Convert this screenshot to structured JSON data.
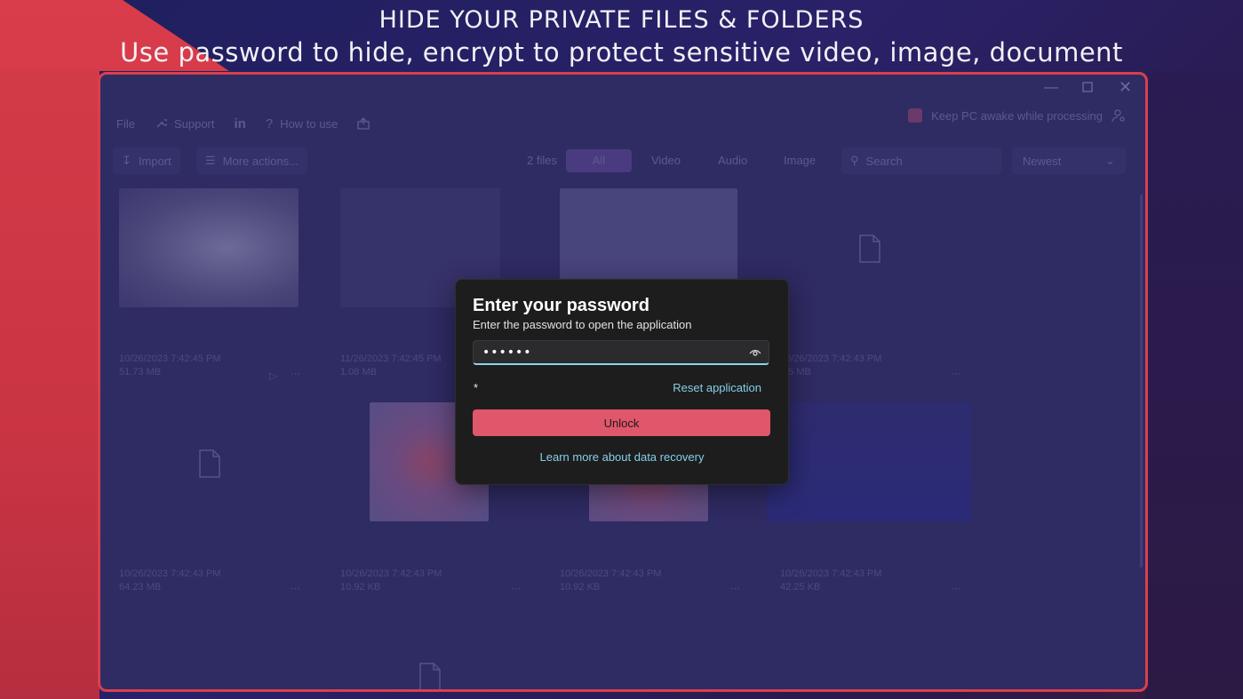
{
  "banner": {
    "headline": "HIDE YOUR PRIVATE FILES & FOLDERS",
    "subheadline": "Use password to hide, encrypt to protect sensitive video, image, document"
  },
  "toolbar": {
    "file": "File",
    "support": "Support",
    "how_to_use": "How to use",
    "keep_awake": "Keep PC awake while processing"
  },
  "filterbar": {
    "import": "Import",
    "more_actions": "More actions...",
    "file_count": "2 files",
    "tabs": [
      "All",
      "Video",
      "Audio",
      "Image"
    ],
    "search_placeholder": "Search",
    "sort": "Newest"
  },
  "files": [
    {
      "date": "10/26/2023 7:42:45 PM",
      "size": "51.73 MB"
    },
    {
      "date": "11/26/2023 7:42:45 PM",
      "size": "1.08 MB"
    },
    {
      "date": "10/26/2023 7:42:43 PM",
      "size": "4.5 MB"
    },
    {
      "date": "10/26/2023 7:42:43 PM",
      "size": "64.23 MB"
    },
    {
      "date": "10/26/2023 7:42:43 PM",
      "size": "10.92 KB"
    },
    {
      "date": "10/26/2023 7:42:43 PM",
      "size": "10.92 KB"
    },
    {
      "date": "10/26/2023 7:42:43 PM",
      "size": "42.25 KB"
    }
  ],
  "dialog": {
    "title": "Enter your password",
    "subtitle": "Enter the password to open the application",
    "password_value": "••••••",
    "asterisk": "*",
    "reset": "Reset application",
    "unlock": "Unlock",
    "learn_more": "Learn more about data recovery"
  },
  "colors": {
    "accent_red": "#d8404e",
    "unlock_button": "#e0566a",
    "link": "#86cfe6"
  }
}
